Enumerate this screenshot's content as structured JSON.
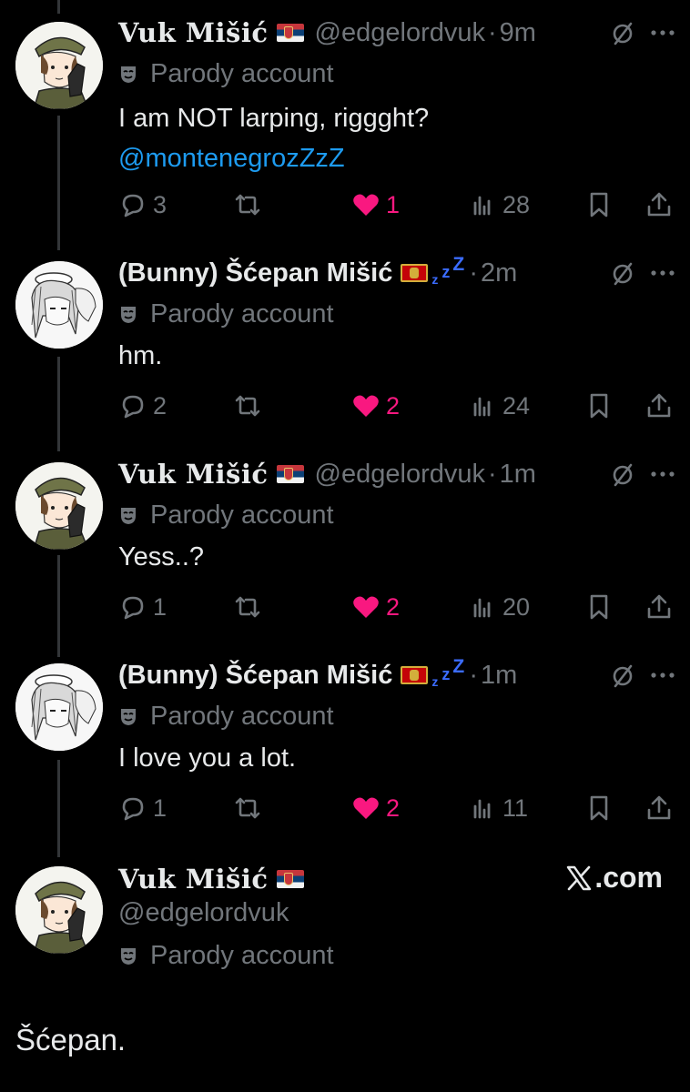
{
  "colors": {
    "background": "#000000",
    "text": "#e7e9ea",
    "muted": "#71767b",
    "link": "#1d9bf0",
    "like": "#f91880",
    "thread_line": "#333639"
  },
  "tweets": [
    {
      "name": "Vuk Mišić",
      "flag": "serbia-flag",
      "handle": "@edgelordvuk",
      "dot": "·",
      "time": "9m",
      "label": "Parody account",
      "text": "I am NOT larping, riggght?",
      "mention": "@montenegrozZzZ",
      "replies": "3",
      "likes": "1",
      "views": "28"
    },
    {
      "name": "(Bunny) Šćepan Mišić",
      "flag": "montenegro-flag",
      "emoji": "zzz",
      "z1": "z",
      "z2": "z",
      "z3": "Z",
      "dot": "·",
      "time": "2m",
      "label": "Parody account",
      "text": "hm.",
      "replies": "2",
      "likes": "2",
      "views": "24"
    },
    {
      "name": "Vuk Mišić",
      "flag": "serbia-flag",
      "handle": "@edgelordvuk",
      "dot": "·",
      "time": "1m",
      "label": "Parody account",
      "text": "Yess..?",
      "replies": "1",
      "likes": "2",
      "views": "20"
    },
    {
      "name": "(Bunny) Šćepan Mišić",
      "flag": "montenegro-flag",
      "emoji": "zzz",
      "z1": "z",
      "z2": "z",
      "z3": "Z",
      "dot": "·",
      "time": "1m",
      "label": "Parody account",
      "text": "I love you a lot.",
      "replies": "1",
      "likes": "2",
      "views": "11"
    }
  ],
  "final_post": {
    "name": "Vuk Mišić",
    "flag": "serbia-flag",
    "handle": "@edgelordvuk",
    "label": "Parody account",
    "brand": ".com",
    "brand_icon": "x-logo",
    "text": "Šćepan."
  }
}
